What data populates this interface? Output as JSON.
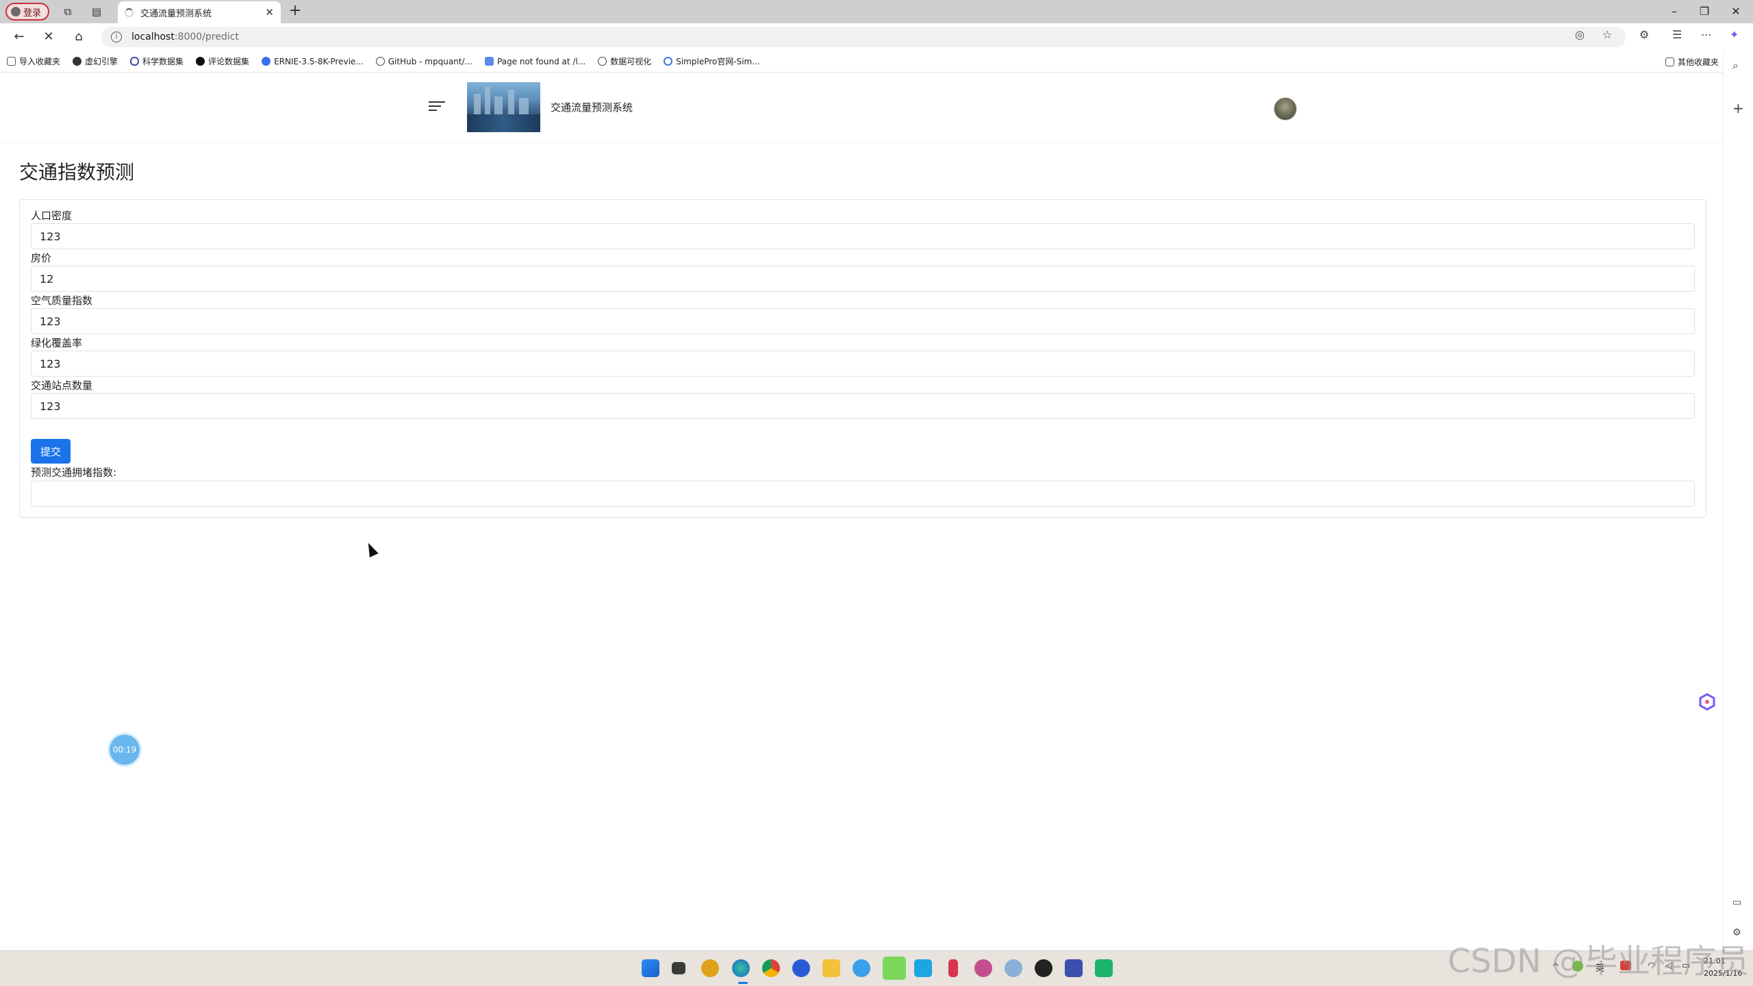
{
  "browser": {
    "profile_label": "登录",
    "tab_title": "交通流量预测系统",
    "url_host": "localhost",
    "url_path": ":8000/predict",
    "bookmarks": [
      {
        "label": "导入收藏夹",
        "icon": "import-icon"
      },
      {
        "label": "虚幻引擎",
        "icon": "unreal-icon"
      },
      {
        "label": "科学数据集",
        "icon": "link-icon"
      },
      {
        "label": "评论数据集",
        "icon": "github-icon"
      },
      {
        "label": "ERNIE-3.5-8K-Previe...",
        "icon": "ernie-icon"
      },
      {
        "label": "GitHub - mpquant/...",
        "icon": "globe-icon"
      },
      {
        "label": "Page not found at /l...",
        "icon": "django-icon"
      },
      {
        "label": "数据可视化",
        "icon": "globe-icon"
      },
      {
        "label": "SimplePro官网-Sim...",
        "icon": "simplepro-icon"
      }
    ],
    "other_bookmarks": "其他收藏夹"
  },
  "header": {
    "title": "交通流量预测系统"
  },
  "page": {
    "title": "交通指数预测"
  },
  "form": {
    "fields": [
      {
        "label": "人口密度",
        "value": "123"
      },
      {
        "label": "房价",
        "value": "12"
      },
      {
        "label": "空气质量指数",
        "value": "123"
      },
      {
        "label": "绿化覆盖率",
        "value": "123"
      },
      {
        "label": "交通站点数量",
        "value": "123"
      }
    ],
    "submit_label": "提交",
    "result_label": "预测交通拥堵指数:",
    "result_value": ""
  },
  "overlay": {
    "timer": "00:19",
    "watermark": "CSDN @毕业程序员"
  },
  "taskbar": {
    "time": "21:01",
    "date": "2025/1/16"
  },
  "colors": {
    "primary_button": "#1a73e8",
    "timer_badge": "#6ab7ee"
  }
}
